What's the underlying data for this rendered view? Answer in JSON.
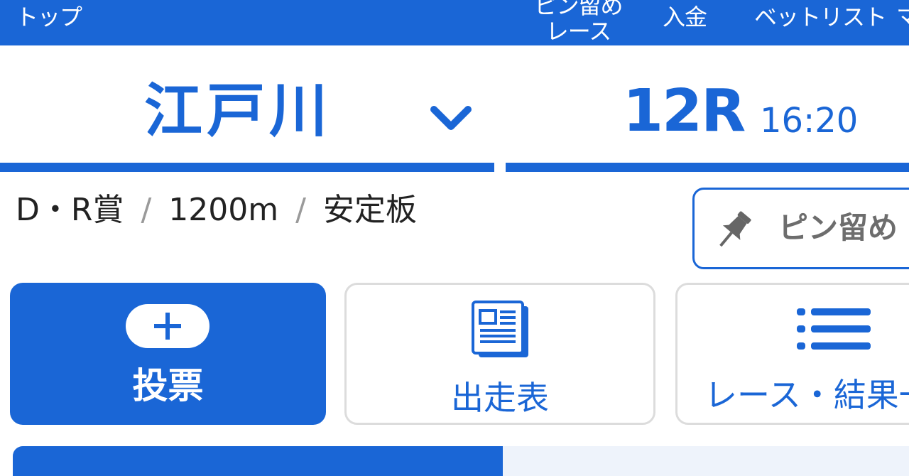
{
  "nav": {
    "top": "トップ",
    "cut_item": "",
    "pinned_race_line1": "ピン留め",
    "pinned_race_line2": "レース",
    "deposit": "入金",
    "bet_list": "ベットリスト",
    "more": "マ"
  },
  "venue": {
    "name": "江戸川",
    "dropdown_icon": "chevron-down-icon"
  },
  "race": {
    "number": "12R",
    "time": "16:20"
  },
  "race_info": {
    "name": "D・R賞",
    "separator": "/",
    "distance": "1200m",
    "condition": "安定板"
  },
  "pin_button": {
    "icon": "pushpin-icon",
    "label": "ピン留め"
  },
  "actions": {
    "vote": {
      "icon": "plus-pill-icon",
      "label": "投票"
    },
    "entries": {
      "icon": "newspaper-icon",
      "label": "出走表"
    },
    "results": {
      "icon": "list-icon",
      "label": "レース・結果一"
    }
  },
  "colors": {
    "brand_blue": "#1a66d6",
    "text_dark": "#222222",
    "muted_gray": "#6d6d6d",
    "border_gray": "#dcdcdc"
  }
}
